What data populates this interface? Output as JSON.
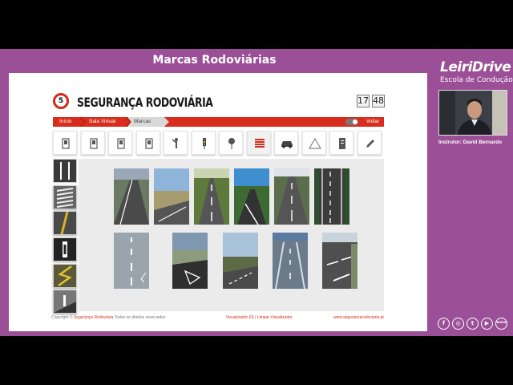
{
  "window": {
    "title": "Marcas Rodoviárias"
  },
  "site": {
    "logo_badge": "5",
    "logo_text": "SEGURANÇA RODOVIÁRIA",
    "clock_hours": "17",
    "clock_minutes": "48"
  },
  "breadcrumb": {
    "items": [
      "Início",
      "Sala Virtual",
      "Marcas"
    ],
    "back_label": "Voltar"
  },
  "toolbar": {
    "categories": [
      {
        "icon": "sign-portrait-icon"
      },
      {
        "icon": "sign-portrait-icon"
      },
      {
        "icon": "sign-portrait-icon"
      },
      {
        "icon": "sign-portrait-icon"
      },
      {
        "icon": "traffic-officer-icon"
      },
      {
        "icon": "traffic-light-icon"
      },
      {
        "icon": "signpost-icon"
      },
      {
        "icon": "road-markings-icon",
        "active": true
      },
      {
        "icon": "car-icon"
      },
      {
        "icon": "warning-triangle-icon"
      },
      {
        "icon": "document-icon"
      },
      {
        "icon": "pencil-icon"
      }
    ]
  },
  "footer": {
    "copyright_prefix": "Copyright ©",
    "copyright_brand": "Segurança Rodoviária",
    "copyright_suffix": "Todos os direitos reservados",
    "viewer": "Visualizador (0)",
    "divider": "|",
    "clear": "Limpar Visualizador",
    "website": "www.segurancarodoviaria.pt"
  },
  "brand": {
    "name": "LeiriDrive",
    "subtitle": "Escola de Condução"
  },
  "instructor": {
    "label": "Instrutor: David Bernardo"
  },
  "social": [
    "f",
    "◎",
    "t",
    "▶",
    "www"
  ],
  "colors": {
    "frame": "#9b4f97",
    "accent": "#d82d1d"
  }
}
